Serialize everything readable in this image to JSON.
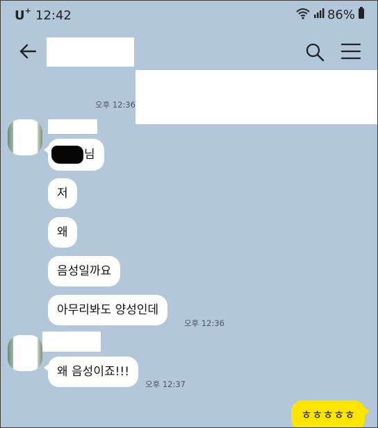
{
  "status_bar": {
    "carrier": "U",
    "carrier_superscript": "+",
    "time": "12:42",
    "battery": "86%",
    "icons": [
      "wifi-icon",
      "signal-icon",
      "battery-icon"
    ]
  },
  "app_bar": {
    "icons": [
      "back-arrow-icon",
      "search-icon",
      "menu-icon"
    ]
  },
  "chat": {
    "first_timestamp": "오후 12:36",
    "group_one": {
      "messages": [
        "님",
        "저",
        "왜",
        "음성일까요",
        "아무리봐도 양성인데"
      ],
      "timestamp": "오후 12:36"
    },
    "group_two": {
      "messages": [
        "왜 음성이죠!!!"
      ],
      "timestamp": "오후 12:37"
    },
    "my_message": "ㅎㅎㅎㅎㅎ"
  },
  "colors": {
    "background": "#b2c7da",
    "my_bubble": "#fee500",
    "other_bubble": "#ffffff"
  }
}
